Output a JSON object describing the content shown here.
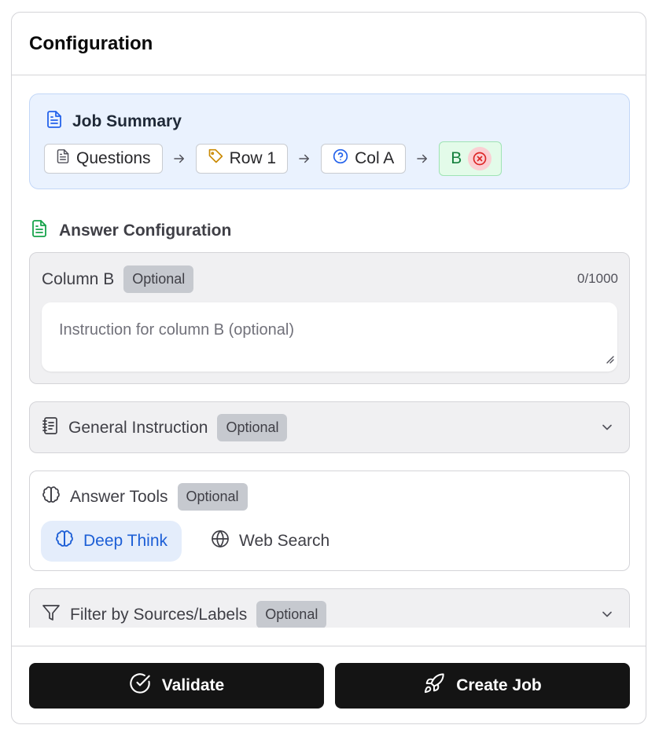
{
  "header": {
    "title": "Configuration"
  },
  "summary": {
    "title": "Job Summary",
    "chips": [
      {
        "label": "Questions",
        "icon": "document-icon"
      },
      {
        "label": "Row 1",
        "icon": "tag-icon"
      },
      {
        "label": "Col A",
        "icon": "help-circle-icon"
      },
      {
        "label": "B",
        "icon": "close-circle-icon"
      }
    ]
  },
  "answer_config": {
    "title": "Answer Configuration",
    "column": {
      "label": "Column B",
      "badge": "Optional",
      "counter": "0/1000",
      "placeholder": "Instruction for column B (optional)"
    },
    "general_instruction": {
      "label": "General Instruction",
      "badge": "Optional"
    },
    "tools": {
      "label": "Answer Tools",
      "badge": "Optional",
      "items": [
        {
          "label": "Deep Think",
          "icon": "brain-icon",
          "active": true
        },
        {
          "label": "Web Search",
          "icon": "globe-icon",
          "active": false
        }
      ]
    },
    "filter": {
      "label": "Filter by Sources/Labels",
      "badge": "Optional"
    }
  },
  "footer": {
    "validate_label": "Validate",
    "create_label": "Create Job"
  },
  "colors": {
    "accent_blue": "#1d5fd6",
    "summary_bg": "#eaf2fe",
    "success_green": "#15803d",
    "button_dark": "#141414"
  }
}
